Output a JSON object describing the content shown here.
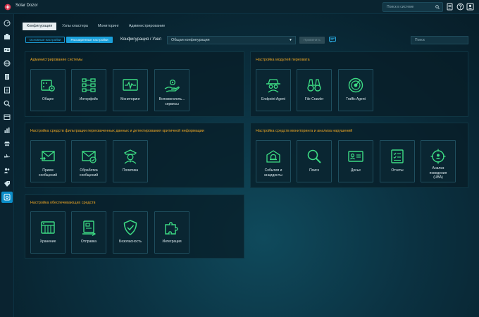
{
  "app": {
    "name": "Solar Dozor"
  },
  "top_search": {
    "placeholder": "Поиск в системе"
  },
  "tabs": [
    {
      "label": "Конфигурация",
      "active": true
    },
    {
      "label": "Узлы кластера",
      "active": false
    },
    {
      "label": "Мониторинг",
      "active": false
    },
    {
      "label": "Администрирование",
      "active": false
    }
  ],
  "filters": {
    "basic_label": "Основные настройки",
    "extended_label": "Расширенные настройки",
    "breadcrumb": "Конфигурация / Узел",
    "config_value": "Общая конфигурация",
    "apply_label": "Применить",
    "search_placeholder": "Поиск"
  },
  "panels": {
    "admin": {
      "title": "Администрирование системы",
      "tiles": [
        "Общее",
        "Интерфейс",
        "Мониторинг",
        "Вспомогатель...\nсервисы"
      ]
    },
    "interception": {
      "title": "Настройка модулей перехвата",
      "tiles": [
        "Endpoint Agent",
        "File Crawler",
        "Traffic Agent"
      ]
    },
    "filtering": {
      "title": "Настройка средств фильтрации перехваченных данных и детектирования критичной информации",
      "tiles": [
        "Прием\nсообщений",
        "Обработка\nсообщений",
        "Политика"
      ]
    },
    "monitoring": {
      "title": "Настройка средств мониторинга и анализа нарушений",
      "tiles": [
        "События и\nинциденты",
        "Поиск",
        "Досье",
        "Отчеты",
        "Анализ\nповедения\n(UBA)"
      ]
    },
    "support": {
      "title": "Настройка обеспечивающих средств",
      "tiles": [
        "Хранение",
        "Отправка",
        "Безопасность",
        "Интеграция"
      ]
    }
  },
  "colors": {
    "accent_green": "#3ddc84",
    "accent_blue": "#1aa0da",
    "title_orange": "#f0a824"
  }
}
